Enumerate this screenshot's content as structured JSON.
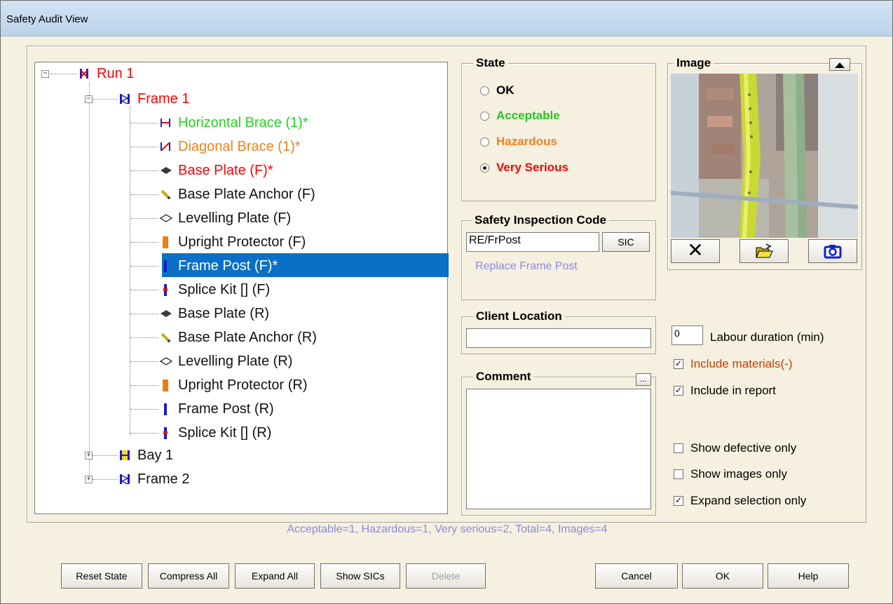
{
  "window": {
    "title": "Safety Audit View"
  },
  "tree": {
    "nodes": [
      {
        "label": "Run 1",
        "color": "#ff0000",
        "icon": "run-icon",
        "expander": "−"
      },
      {
        "label": "Frame 1",
        "color": "#ff0000",
        "icon": "frame-icon",
        "expander": "−"
      },
      {
        "label": "Horizontal Brace (1)*",
        "color": "#22d422",
        "icon": "horizontal-brace-icon"
      },
      {
        "label": "Diagonal Brace (1)*",
        "color": "#f0821e",
        "icon": "diagonal-brace-icon"
      },
      {
        "label": "Base Plate (F)*",
        "color": "#ff0000",
        "icon": "base-plate-icon"
      },
      {
        "label": "Base Plate Anchor (F)",
        "color": "#111111",
        "icon": "base-plate-anchor-icon"
      },
      {
        "label": "Levelling Plate (F)",
        "color": "#111111",
        "icon": "levelling-plate-icon"
      },
      {
        "label": "Upright Protector (F)",
        "color": "#111111",
        "icon": "upright-protector-icon"
      },
      {
        "label": "Frame Post (F)*",
        "color": "#ffffff",
        "icon": "frame-post-icon",
        "selected": true
      },
      {
        "label": "Splice Kit [] (F)",
        "color": "#111111",
        "icon": "splice-kit-icon"
      },
      {
        "label": "Base Plate (R)",
        "color": "#111111",
        "icon": "base-plate-icon"
      },
      {
        "label": "Base Plate Anchor (R)",
        "color": "#111111",
        "icon": "base-plate-anchor-icon"
      },
      {
        "label": "Levelling Plate (R)",
        "color": "#111111",
        "icon": "levelling-plate-icon"
      },
      {
        "label": "Upright Protector (R)",
        "color": "#111111",
        "icon": "upright-protector-icon"
      },
      {
        "label": "Frame Post (R)",
        "color": "#111111",
        "icon": "frame-post-icon"
      },
      {
        "label": "Splice Kit [] (R)",
        "color": "#111111",
        "icon": "splice-kit-icon"
      },
      {
        "label": "Bay 1",
        "color": "#111111",
        "icon": "bay-icon",
        "expander": "+"
      },
      {
        "label": "Frame 2",
        "color": "#111111",
        "icon": "frame-icon",
        "expander": "+"
      }
    ]
  },
  "state": {
    "title": "State",
    "options": [
      {
        "label": "OK",
        "color": "#000000",
        "checked": false
      },
      {
        "label": "Acceptable",
        "color": "#22c822",
        "checked": false
      },
      {
        "label": "Hazardous",
        "color": "#f0821e",
        "checked": false
      },
      {
        "label": "Very Serious",
        "color": "#ff0000",
        "checked": true
      }
    ]
  },
  "sic": {
    "title": "Safety Inspection Code",
    "value": "RE/FrPost",
    "button": "SIC",
    "description": "Replace Frame Post"
  },
  "client_location": {
    "title": "Client Location",
    "value": ""
  },
  "comment": {
    "title": "Comment",
    "button": "...",
    "value": ""
  },
  "image": {
    "title": "Image",
    "collapse_icon": "triangle-up-icon"
  },
  "image_buttons": {
    "delete": "close-x-icon",
    "open": "folder-open-icon",
    "camera": "camera-icon"
  },
  "labour": {
    "value": "0",
    "label": "Labour duration (min)"
  },
  "checks": {
    "include_materials": {
      "label": "Include materials(-)",
      "checked": true,
      "color": "#c04000"
    },
    "include_in_report": {
      "label": "Include in report",
      "checked": true
    },
    "show_defective_only": {
      "label": "Show defective only",
      "checked": false
    },
    "show_images_only": {
      "label": "Show images only",
      "checked": false
    },
    "expand_selection_only": {
      "label": "Expand selection only",
      "checked": true
    }
  },
  "status_text": "Acceptable=1, Hazardous=1, Very serious=2, Total=4, Images=4",
  "buttons": {
    "reset_state": "Reset State",
    "compress_all": "Compress All",
    "expand_all": "Expand All",
    "show_sics": "Show SICs",
    "delete": "Delete",
    "cancel": "Cancel",
    "ok": "OK",
    "help": "Help"
  }
}
